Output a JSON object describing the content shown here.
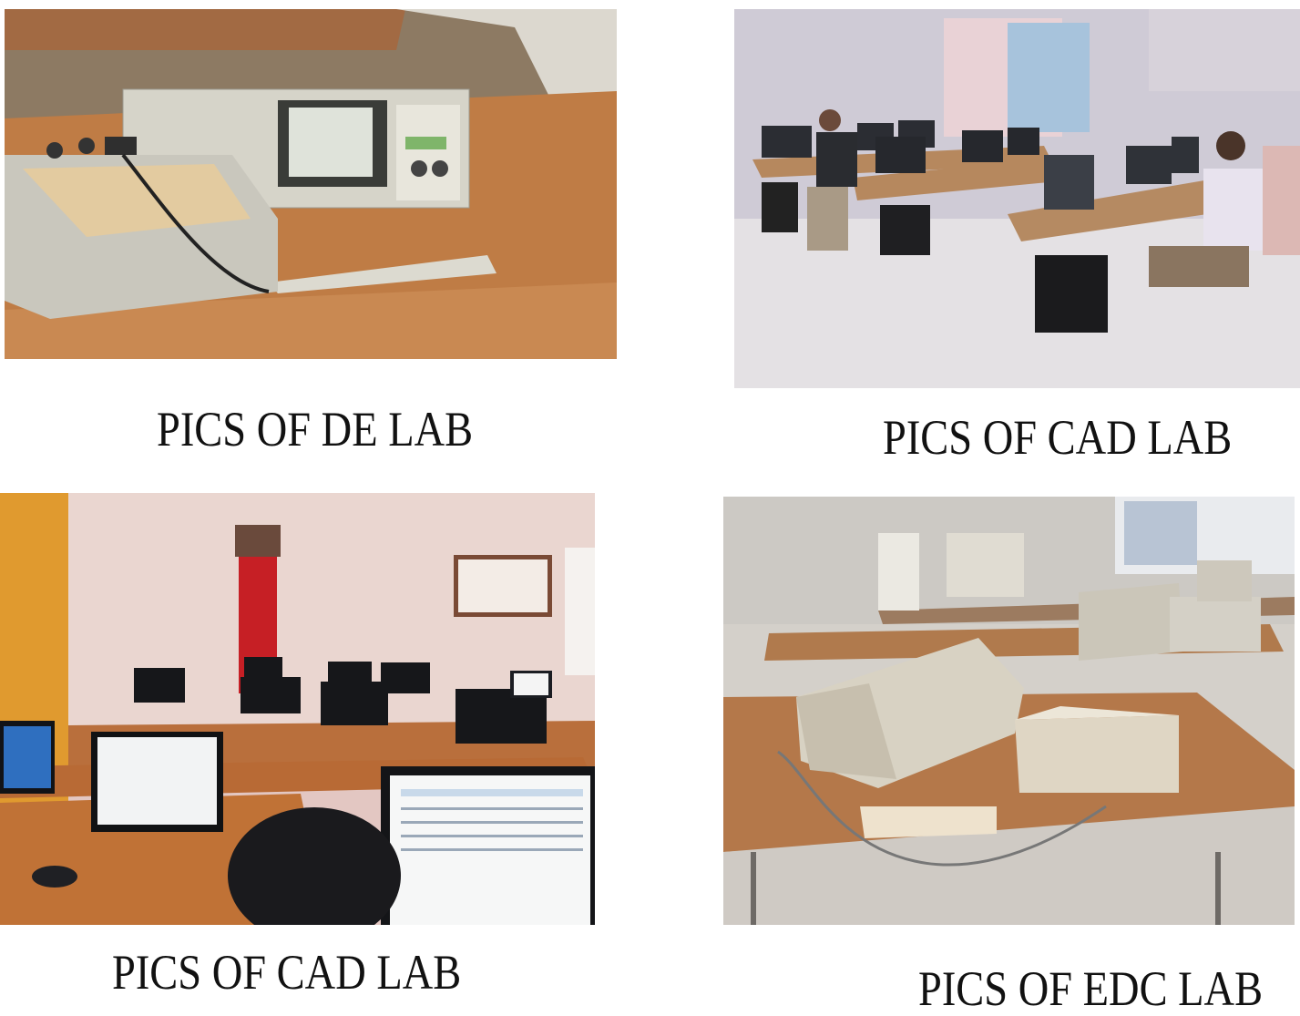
{
  "figures": [
    {
      "caption": "PICS OF DE LAB",
      "photo_icon": "oscilloscope-trainer-photo"
    },
    {
      "caption": "PICS OF CAD LAB",
      "photo_icon": "computer-lab-students-photo"
    },
    {
      "caption": "PICS OF CAD LAB",
      "photo_icon": "computer-lab-monitors-photo"
    },
    {
      "caption": "PICS OF EDC LAB",
      "photo_icon": "electronics-lab-equipment-photo"
    }
  ]
}
